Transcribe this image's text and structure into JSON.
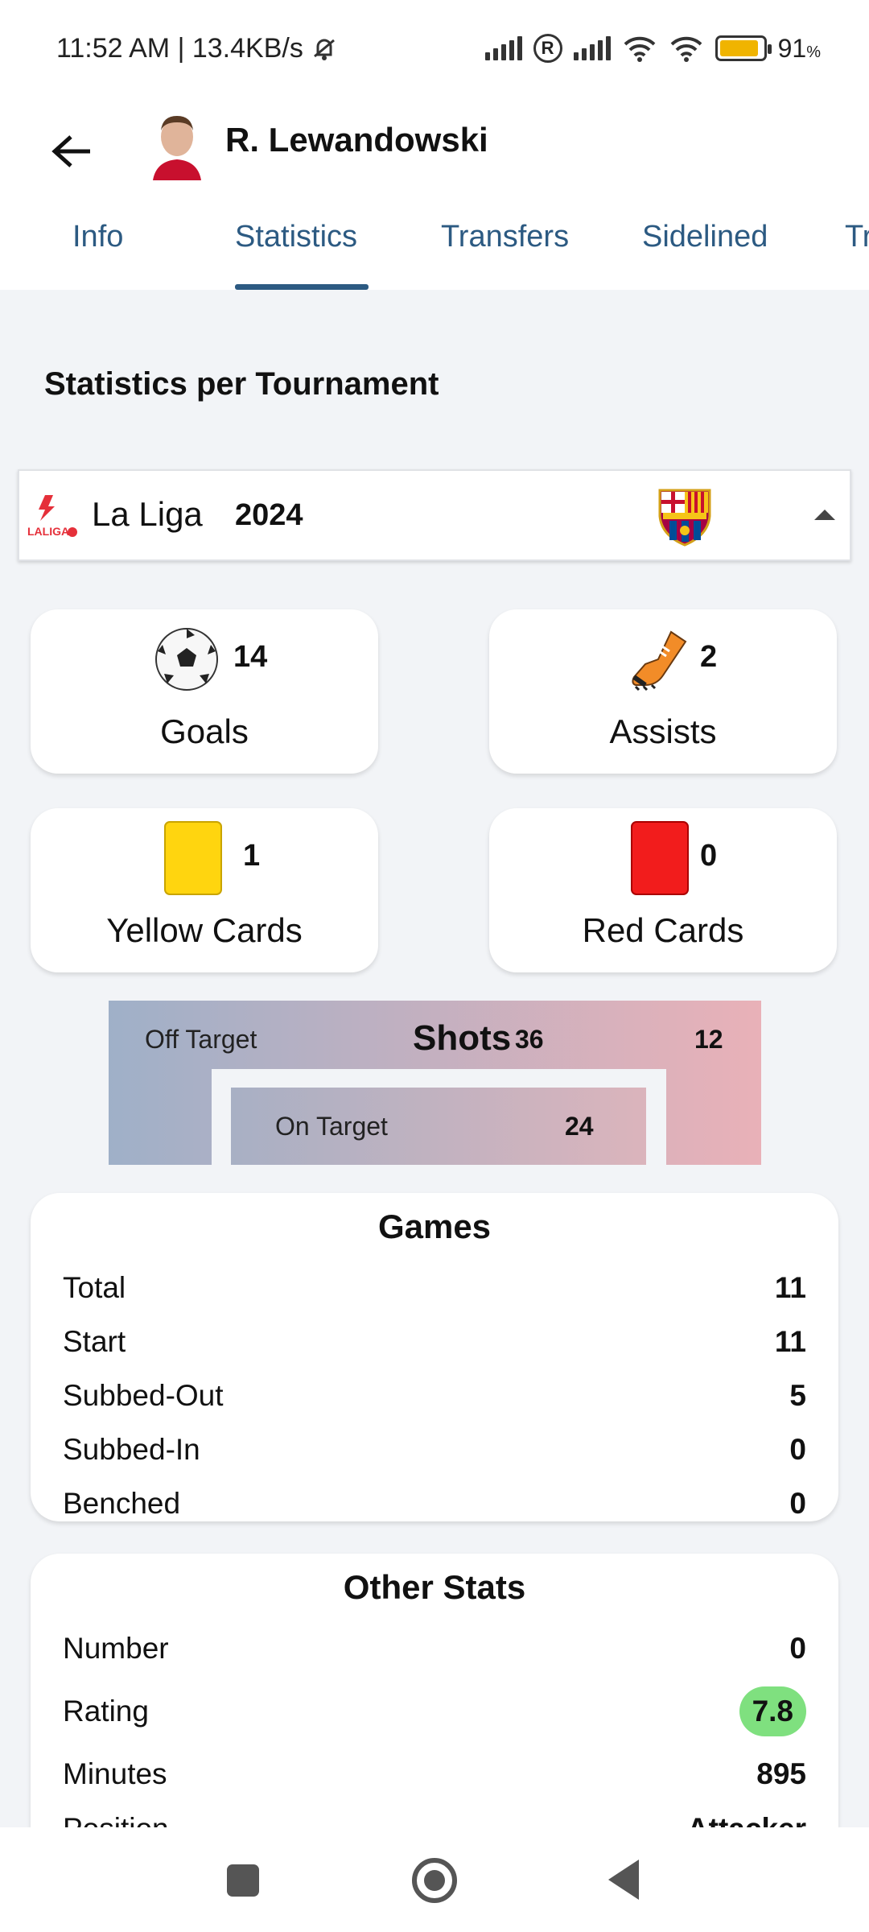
{
  "status_bar": {
    "time_speed": "11:52 AM | 13.4KB/s",
    "battery_percent": "91",
    "battery_symbol": "%",
    "battery_level": 0.91,
    "r_badge": "R"
  },
  "header": {
    "player_name": "R. Lewandowski",
    "back_icon": "arrow-left-icon",
    "tabs": [
      "Info",
      "Statistics",
      "Transfers",
      "Sidelined",
      "Tr"
    ],
    "active_tab": "Statistics"
  },
  "section": {
    "title": "Statistics per Tournament"
  },
  "tournament_select": {
    "league": "La Liga",
    "season": "2024",
    "league_logo_text": "LALIGA"
  },
  "cards": {
    "goals": {
      "value": "14",
      "label": "Goals",
      "icon": "football-icon"
    },
    "assists": {
      "value": "2",
      "label": "Assists",
      "icon": "boot-icon"
    },
    "yellow": {
      "value": "1",
      "label": "Yellow Cards",
      "icon": "yellow-card-icon"
    },
    "red": {
      "value": "0",
      "label": "Red Cards",
      "icon": "red-card-icon"
    }
  },
  "shots": {
    "label": "Shots",
    "total": "36",
    "off_label": "Off Target",
    "off_value": "12",
    "on_label": "On Target",
    "on_value": "24"
  },
  "games": {
    "title": "Games",
    "rows": [
      {
        "label": "Total",
        "value": "11"
      },
      {
        "label": "Start",
        "value": "11"
      },
      {
        "label": "Subbed-Out",
        "value": "5"
      },
      {
        "label": "Subbed-In",
        "value": "0"
      },
      {
        "label": "Benched",
        "value": "0"
      }
    ]
  },
  "other": {
    "title": "Other Stats",
    "rows": [
      {
        "label": "Number",
        "value": "0"
      },
      {
        "label": "Rating",
        "value": "7.8"
      },
      {
        "label": "Minutes",
        "value": "895"
      },
      {
        "label": "Position",
        "value": "Attacker"
      }
    ]
  },
  "colors": {
    "accent": "#2c5a82",
    "rating_badge": "#7fe07f",
    "shots_left": "#9fb0c8",
    "shots_right": "#e9b1b8"
  }
}
